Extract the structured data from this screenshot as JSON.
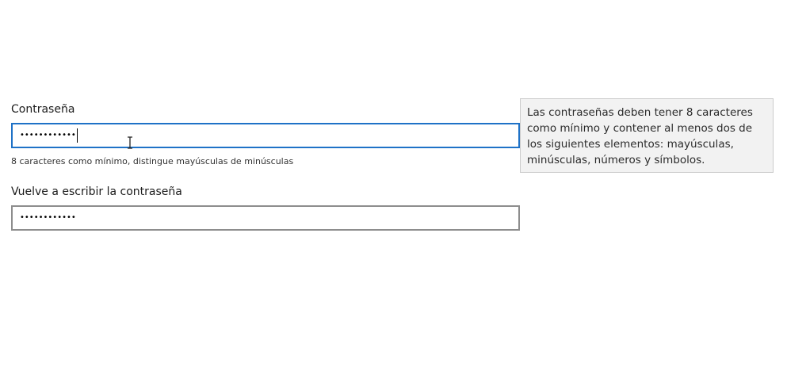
{
  "password": {
    "label": "Contraseña",
    "masked_value": "••••••••••••",
    "hint": "8 caracteres como mínimo, distingue mayúsculas de minúsculas"
  },
  "confirm": {
    "label": "Vuelve a escribir la contraseña",
    "masked_value": "••••••••••••"
  },
  "tooltip": {
    "text": "Las contraseñas deben tener 8 caracteres como mínimo y contener al menos dos de los siguientes elementos: mayúsculas, minúsculas, números y símbolos."
  },
  "colors": {
    "focus_border": "#1f72c7",
    "default_border": "#8d8d8d",
    "tooltip_background": "#f2f2f2"
  },
  "icons": {
    "cursor": "text-cursor-icon"
  }
}
